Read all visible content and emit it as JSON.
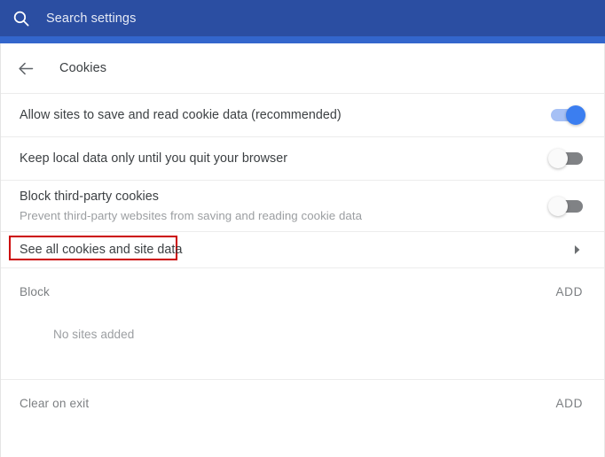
{
  "window": {
    "title": "Chrome Settings — Cookies",
    "colors": {
      "topbar_dark": "#2b4ea2",
      "topbar_accent": "#3366cc",
      "toggle_on": "#3b7ef0",
      "toggle_on_track": "#a6c0f5",
      "toggle_off_track": "#808285",
      "highlight_border": "#cc0000",
      "text_primary": "#3c4043",
      "text_secondary": "#9b9ea1",
      "divider": "#ececec"
    }
  },
  "topbar": {
    "search_icon": "search-icon",
    "search_placeholder": "Search settings",
    "search_value": ""
  },
  "subheader": {
    "back_icon": "arrow-left-icon",
    "title": "Cookies"
  },
  "settings": [
    {
      "id": "allow-cookies",
      "title": "Allow sites to save and read cookie data (recommended)",
      "subtitle": "",
      "toggle_state": "on"
    },
    {
      "id": "keep-local-data",
      "title": "Keep local data only until you quit your browser",
      "subtitle": "",
      "toggle_state": "off"
    },
    {
      "id": "block-third-party",
      "title": "Block third-party cookies",
      "subtitle": "Prevent third-party websites from saving and reading cookie data",
      "toggle_state": "off"
    }
  ],
  "link_row": {
    "label": "See all cookies and site data",
    "chevron_icon": "chevron-right-icon",
    "highlighted": true
  },
  "sections": [
    {
      "id": "block",
      "title": "Block",
      "add_label": "ADD",
      "empty_text": "No sites added"
    },
    {
      "id": "clear-on-exit",
      "title": "Clear on exit",
      "add_label": "ADD",
      "empty_text": ""
    }
  ]
}
